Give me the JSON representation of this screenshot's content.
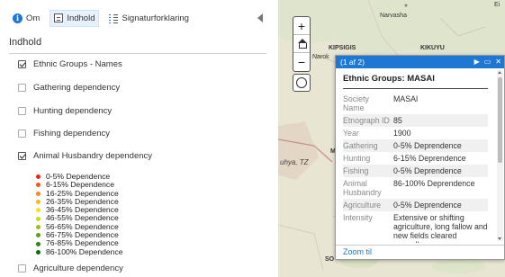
{
  "tabs": [
    {
      "label": "Om",
      "icon": "info-icon"
    },
    {
      "label": "Indhold",
      "icon": "layers-list-icon",
      "active": true
    },
    {
      "label": "Signaturforklaring",
      "icon": "legend-icon"
    }
  ],
  "panel_title": "Indhold",
  "layers": [
    {
      "label": "Ethnic Groups - Names",
      "checked": true
    },
    {
      "label": "Gathering dependency",
      "checked": false
    },
    {
      "label": "Hunting dependency",
      "checked": false
    },
    {
      "label": "Fishing dependency",
      "checked": false
    },
    {
      "label": "Animal Husbandry dependency",
      "checked": true
    },
    {
      "label": "Agriculture dependency",
      "checked": false
    }
  ],
  "legend": [
    {
      "label": "0-5% Dependence",
      "color": "#e8271b"
    },
    {
      "label": "6-15% Dependence",
      "color": "#ef5a18"
    },
    {
      "label": "16-25% Dependence",
      "color": "#f28c1a"
    },
    {
      "label": "26-35% Dependence",
      "color": "#f5b81c"
    },
    {
      "label": "36-45% Dependence",
      "color": "#f4e21e"
    },
    {
      "label": "46-55% Dependence",
      "color": "#c9d91d"
    },
    {
      "label": "56-65% Dependence",
      "color": "#95c21b"
    },
    {
      "label": "66-75% Dependence",
      "color": "#5aa218"
    },
    {
      "label": "76-85% Dependence",
      "color": "#2e8414"
    },
    {
      "label": "86-100% Dependence",
      "color": "#116a10"
    }
  ],
  "map": {
    "labels": [
      {
        "text": "Narvasha"
      },
      {
        "text": "KIPSIGIS"
      },
      {
        "text": "KIKUYU"
      },
      {
        "text": "Narok"
      },
      {
        "text": "uhya, TZ"
      },
      {
        "text": "M"
      },
      {
        "text": "SO"
      },
      {
        "text": "Ei"
      }
    ],
    "zoom_in": "+",
    "zoom_out": "−"
  },
  "popup": {
    "counter": "(1 af 2)",
    "title": "Ethnic Groups: MASAI",
    "attributes": [
      {
        "key": "Society Name",
        "value": "MASAI"
      },
      {
        "key": "Etnograph ID",
        "value": "85"
      },
      {
        "key": "Year",
        "value": "1900"
      },
      {
        "key": "Gathering",
        "value": "0-5% Deprendence"
      },
      {
        "key": "Hunting",
        "value": "6-15% Deprendence"
      },
      {
        "key": "Fishing",
        "value": "0-5% Deprendence"
      },
      {
        "key": "Animal Husbandry",
        "value": "86-100% Deprendence"
      },
      {
        "key": "Agriculture",
        "value": "0-5% Deprendence"
      },
      {
        "key": "Intensity",
        "value": "Extensive or shifting agriculture, long fallow and new fields cleared annually"
      }
    ],
    "zoom_link": "Zoom til",
    "next_glyph": "▶",
    "maximize_glyph": "▭",
    "close_glyph": "✕"
  }
}
